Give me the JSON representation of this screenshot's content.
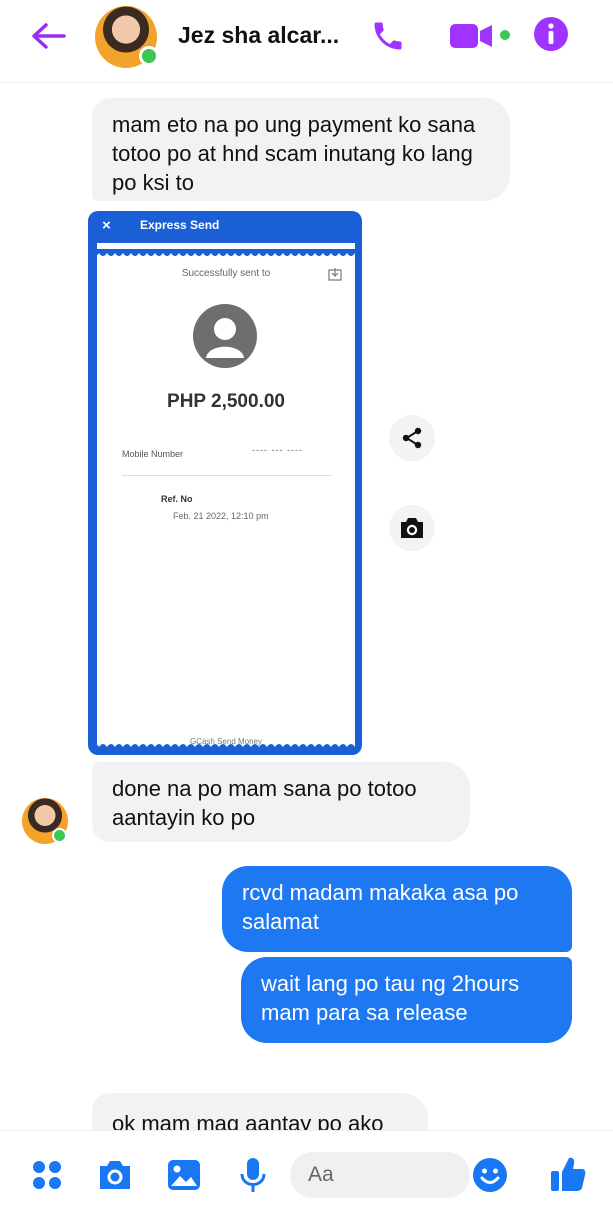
{
  "header": {
    "contact_name": "Jez sha alcar...",
    "icons": [
      "back-arrow-icon",
      "phone-icon",
      "video-camera-icon",
      "info-icon"
    ],
    "accent_color": "#a033ff"
  },
  "messages": {
    "m1": "mam eto na po ung payment ko sana totoo po at hnd scam inutang ko lang po ksi to",
    "m2": "done na po mam sana po totoo aantayin ko po",
    "m3": "rcvd madam makaka asa po salamat",
    "m4": "wait lang po tau ng 2hours mam para sa release",
    "m5": "ok mam mag aantay po ako"
  },
  "receipt": {
    "header_title": "Express Send",
    "close_glyph": "×",
    "status": "Successfully sent to",
    "amount": "PHP 2,500.00",
    "mobile_label": "Mobile Number",
    "mobile_value": "---- --- ----",
    "ref_label": "Ref. No",
    "datetime": "Feb. 21 2022, 12:10 pm",
    "footer": "GCash Send Money"
  },
  "composer": {
    "placeholder": "Aa",
    "icons": [
      "menu-dots-icon",
      "camera-icon",
      "gallery-icon",
      "microphone-icon",
      "emoji-icon",
      "like-icon"
    ]
  },
  "colors": {
    "sent_bubble": "#1e78f2",
    "received_bubble": "#f2f2f5",
    "gcash_blue": "#1b5fd6"
  }
}
